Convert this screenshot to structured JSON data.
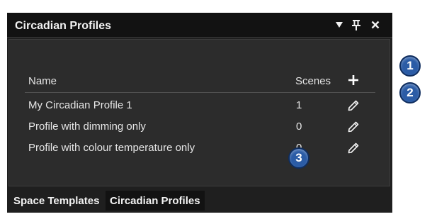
{
  "panel": {
    "title": "Circadian Profiles",
    "icons": {
      "menu": "triangle-down-icon",
      "pin": "pin-icon",
      "close": "close-icon"
    }
  },
  "table": {
    "headers": {
      "name": "Name",
      "scenes": "Scenes"
    },
    "add_icon": "plus-icon",
    "edit_icon": "pencil-icon",
    "rows": [
      {
        "name": "My Circadian Profile 1",
        "scenes": "1"
      },
      {
        "name": "Profile with dimming only",
        "scenes": "0"
      },
      {
        "name": "Profile with colour temperature only",
        "scenes": "0"
      }
    ]
  },
  "tabs": [
    {
      "label": "Space Templates",
      "active": false
    },
    {
      "label": "Circadian Profiles",
      "active": true
    }
  ],
  "callouts": [
    "1",
    "2",
    "3"
  ],
  "colors": {
    "panel_bg": "#1f1f1f",
    "content_bg": "#2c2c2c",
    "callout": "#2b5ca6"
  }
}
